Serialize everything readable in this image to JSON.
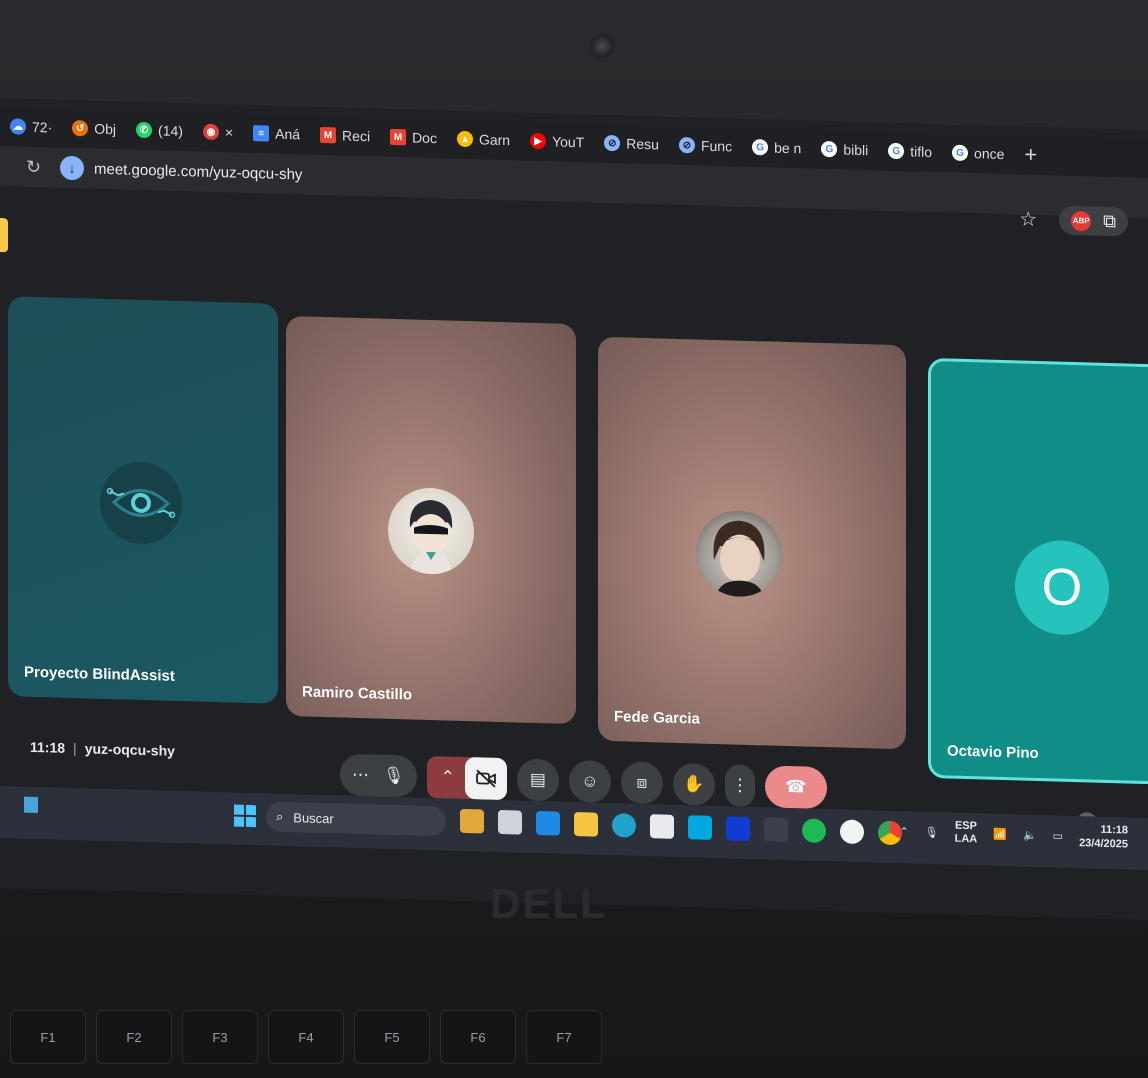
{
  "browser": {
    "tabs": [
      {
        "label": "72·",
        "icon": "cloud-icon",
        "color": "#4285f4"
      },
      {
        "label": "Obj",
        "icon": "history-icon",
        "color": "#e8710a"
      },
      {
        "label": "(14)",
        "icon": "whatsapp-icon",
        "color": "#25d366"
      },
      {
        "label": "",
        "icon": "colorful-app-icon",
        "color": "#db4437"
      },
      {
        "label": "Aná",
        "icon": "docs-icon",
        "color": "#4285f4"
      },
      {
        "label": "Reci",
        "icon": "gmail-icon",
        "color": "#ea4335"
      },
      {
        "label": "Doc",
        "icon": "gmail-icon",
        "color": "#ea4335"
      },
      {
        "label": "Garn",
        "icon": "drive-icon",
        "color": "#fbbc04"
      },
      {
        "label": "YouT",
        "icon": "youtube-icon",
        "color": "#ff0000"
      },
      {
        "label": "Resu",
        "icon": "compass-icon",
        "color": "#8ab4f8"
      },
      {
        "label": "Func",
        "icon": "compass-icon",
        "color": "#8ab4f8"
      },
      {
        "label": "be n",
        "icon": "google-icon",
        "color": "#ffffff"
      },
      {
        "label": "bibli",
        "icon": "google-icon",
        "color": "#ffffff"
      },
      {
        "label": "tiflo",
        "icon": "google-icon",
        "color": "#ffffff"
      },
      {
        "label": "once",
        "icon": "google-icon",
        "color": "#ffffff"
      }
    ],
    "close_label": "×",
    "new_tab_label": "+",
    "url": "meet.google.com/yuz-oqcu-shy",
    "abp_label": "ABP"
  },
  "meet": {
    "tiles": [
      {
        "name": "Proyecto BlindAssist"
      },
      {
        "name": "Ramiro Castillo"
      },
      {
        "name": "Fede Garcia"
      },
      {
        "name": "Octavio Pino",
        "initial": "O"
      }
    ],
    "time": "11:18",
    "separator": "|",
    "code": "yuz-oqcu-shy",
    "participants_count": "4",
    "accent": "#5ee3dd"
  },
  "taskbar": {
    "search_label": "Buscar",
    "lang_line1": "ESP",
    "lang_line2": "LAA",
    "clock_time": "11:18",
    "clock_date": "23/4/2025"
  },
  "keyboard": {
    "brand": "DELL",
    "keys": [
      "F1",
      "F2",
      "F3",
      "F4",
      "F5",
      "F6",
      "F7"
    ]
  }
}
